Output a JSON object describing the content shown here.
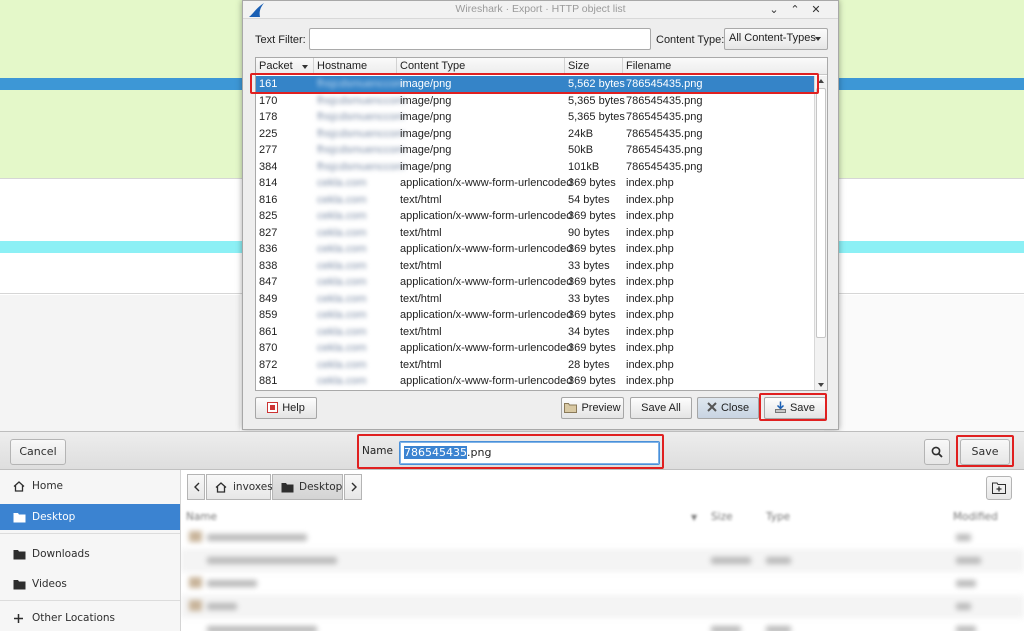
{
  "export_dialog": {
    "title": "Wireshark · Export · HTTP object list",
    "window_buttons": [
      "⌄",
      "⌃",
      "✕"
    ],
    "text_filter_label": "Text Filter:",
    "text_filter_value": "",
    "content_type_label": "Content Type:",
    "content_type_value": "All Content-Types",
    "columns": [
      "Packet",
      "Hostname",
      "Content Type",
      "Size",
      "Filename"
    ],
    "rows": [
      {
        "packet": "161",
        "hostname": "fhsjcdsmuenccom",
        "content_type": "image/png",
        "size": "5,562 bytes",
        "filename": "786545435.png",
        "selected": true
      },
      {
        "packet": "170",
        "hostname": "fhsjcdsmuenccom",
        "content_type": "image/png",
        "size": "5,365 bytes",
        "filename": "786545435.png"
      },
      {
        "packet": "178",
        "hostname": "fhsjcdsmuenccom",
        "content_type": "image/png",
        "size": "5,365 bytes",
        "filename": "786545435.png"
      },
      {
        "packet": "225",
        "hostname": "fhsjcdsmuenccom",
        "content_type": "image/png",
        "size": "24kB",
        "filename": "786545435.png"
      },
      {
        "packet": "277",
        "hostname": "fhsjcdsmuenccom",
        "content_type": "image/png",
        "size": "50kB",
        "filename": "786545435.png"
      },
      {
        "packet": "384",
        "hostname": "fhsjcdsmuenccom",
        "content_type": "image/png",
        "size": "101kB",
        "filename": "786545435.png"
      },
      {
        "packet": "814",
        "hostname": "cekla.com",
        "content_type": "application/x-www-form-urlencoded",
        "size": "369 bytes",
        "filename": "index.php"
      },
      {
        "packet": "816",
        "hostname": "cekla.com",
        "content_type": "text/html",
        "size": "54 bytes",
        "filename": "index.php"
      },
      {
        "packet": "825",
        "hostname": "cekla.com",
        "content_type": "application/x-www-form-urlencoded",
        "size": "369 bytes",
        "filename": "index.php"
      },
      {
        "packet": "827",
        "hostname": "cekla.com",
        "content_type": "text/html",
        "size": "90 bytes",
        "filename": "index.php"
      },
      {
        "packet": "836",
        "hostname": "cekla.com",
        "content_type": "application/x-www-form-urlencoded",
        "size": "369 bytes",
        "filename": "index.php"
      },
      {
        "packet": "838",
        "hostname": "cekla.com",
        "content_type": "text/html",
        "size": "33 bytes",
        "filename": "index.php"
      },
      {
        "packet": "847",
        "hostname": "cekla.com",
        "content_type": "application/x-www-form-urlencoded",
        "size": "369 bytes",
        "filename": "index.php"
      },
      {
        "packet": "849",
        "hostname": "cekla.com",
        "content_type": "text/html",
        "size": "33 bytes",
        "filename": "index.php"
      },
      {
        "packet": "859",
        "hostname": "cekla.com",
        "content_type": "application/x-www-form-urlencoded",
        "size": "369 bytes",
        "filename": "index.php"
      },
      {
        "packet": "861",
        "hostname": "cekla.com",
        "content_type": "text/html",
        "size": "34 bytes",
        "filename": "index.php"
      },
      {
        "packet": "870",
        "hostname": "cekla.com",
        "content_type": "application/x-www-form-urlencoded",
        "size": "369 bytes",
        "filename": "index.php"
      },
      {
        "packet": "872",
        "hostname": "cekla.com",
        "content_type": "text/html",
        "size": "28 bytes",
        "filename": "index.php"
      },
      {
        "packet": "881",
        "hostname": "cekla.com",
        "content_type": "application/x-www-form-urlencoded",
        "size": "369 bytes",
        "filename": "index.php"
      }
    ],
    "buttons": {
      "help": "Help",
      "preview": "Preview",
      "save_all": "Save All",
      "close": "Close",
      "save": "Save"
    }
  },
  "file_chooser": {
    "cancel": "Cancel",
    "name_label": "Name",
    "name_selected": "786545435",
    "name_rest": ".png",
    "save": "Save",
    "places": [
      {
        "label": "Home",
        "icon": "home-icon"
      },
      {
        "label": "Desktop",
        "icon": "folder-icon",
        "active": true
      },
      {
        "label": "Downloads",
        "icon": "folder-icon"
      },
      {
        "label": "Videos",
        "icon": "folder-icon"
      },
      {
        "label": "Other Locations",
        "icon": "plus-icon"
      }
    ],
    "path": {
      "user": "invoxes",
      "current": "Desktop"
    },
    "columns": {
      "name": "Name",
      "size": "Size",
      "type": "Type",
      "modified": "Modified"
    }
  },
  "colors": {
    "selection": "#3584c8",
    "highlight_box": "#e02020",
    "wireshark_row_green": "#e4f8c9"
  }
}
